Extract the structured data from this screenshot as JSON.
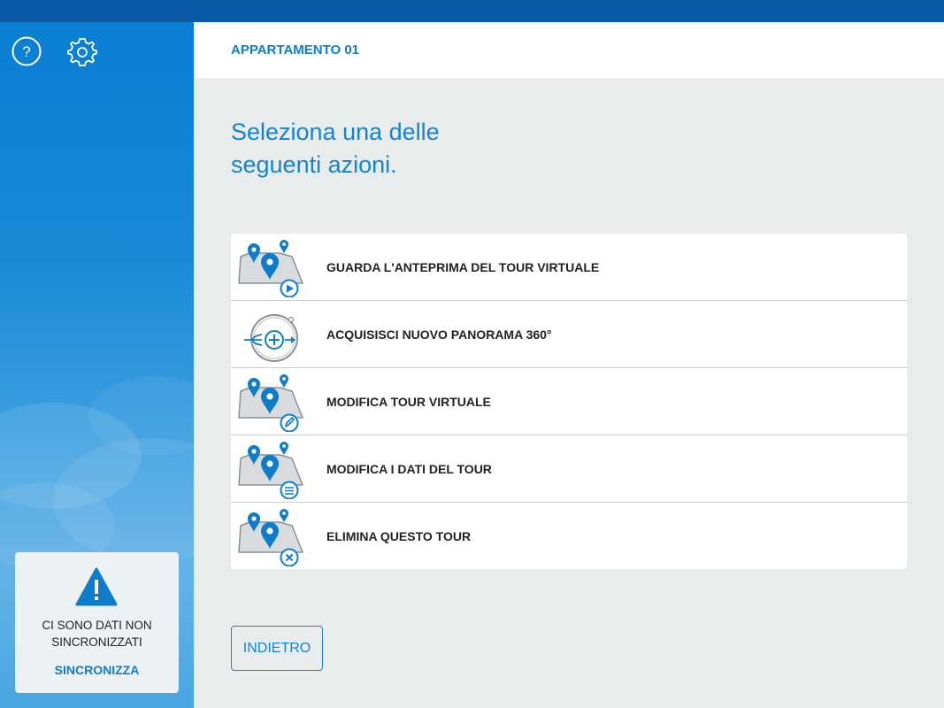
{
  "header": {
    "title": "APPARTAMENTO 01"
  },
  "sidebar": {
    "help_icon": "help-icon",
    "settings_icon": "gear-icon",
    "sync_card": {
      "icon": "warning-icon",
      "message_line1": "CI SONO DATI NON",
      "message_line2": "SINCRONIZZATI",
      "link": "SINCRONIZZA"
    }
  },
  "main": {
    "prompt": "Seleziona una delle\nseguenti azioni.",
    "actions": [
      {
        "label": "GUARDA L'ANTEPRIMA DEL TOUR VIRTUALE",
        "icon": "map-play-icon"
      },
      {
        "label": "ACQUISISCI NUOVO PANORAMA 360°",
        "icon": "panorama-add-icon"
      },
      {
        "label": "MODIFICA TOUR VIRTUALE",
        "icon": "map-edit-icon"
      },
      {
        "label": "MODIFICA I DATI DEL TOUR",
        "icon": "map-list-icon"
      },
      {
        "label": "ELIMINA QUESTO TOUR",
        "icon": "map-delete-icon"
      }
    ],
    "back_button": "INDIETRO"
  },
  "colors": {
    "accent": "#1584cf",
    "topbar": "#0a5aa6",
    "pin": "#0f7cc9",
    "content_bg": "#e8ecec"
  }
}
